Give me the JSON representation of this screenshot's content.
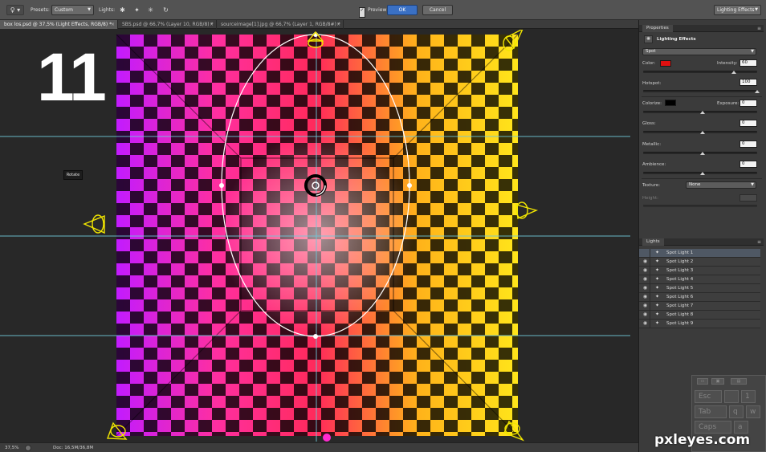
{
  "options_bar": {
    "tool_icon": "lightbulb-icon",
    "presets_label": "Presets:",
    "presets_value": "Custom",
    "lights_label": "Lights:",
    "preview_label": "Preview",
    "preview_checked": "✓",
    "ok_label": "OK",
    "cancel_label": "Cancel",
    "workspace_value": "Lighting Effects"
  },
  "tabs": [
    {
      "label": "box los.psd @ 37,5% (Light Effects, RGB/8) *",
      "active": true
    },
    {
      "label": "SBS.psd @ 66,7% (Layer 10, RGB/8) *",
      "active": false
    },
    {
      "label": "sourceimage[1].jpg @ 66,7% (Layer 1, RGB/8#) *",
      "active": false
    }
  ],
  "canvas": {
    "overlay_number": "11",
    "tooltip": "Rotate"
  },
  "status": {
    "zoom": "37,5%",
    "doc": "Doc: 16,5M/36,8M"
  },
  "properties": {
    "panel_title": "Properties",
    "effect_title": "Lighting Effects",
    "light_type": "Spot",
    "color_label": "Color:",
    "color_value": "#e01010",
    "intensity_label": "Intensity:",
    "intensity": "60",
    "hotspot_label": "Hotspot:",
    "hotspot": "100",
    "colorize_label": "Colorize:",
    "colorize_value": "#000000",
    "exposure_label": "Exposure:",
    "exposure": "0",
    "gloss_label": "Gloss:",
    "gloss": "0",
    "metallic_label": "Metallic:",
    "metallic": "0",
    "ambience_label": "Ambience:",
    "ambience": "0",
    "texture_label": "Texture:",
    "texture_value": "None",
    "height_label": "Height:"
  },
  "lights_panel": {
    "title": "Lights",
    "items": [
      "Spot Light 1",
      "Spot Light 2",
      "Spot Light 3",
      "Spot Light 4",
      "Spot Light 5",
      "Spot Light 6",
      "Spot Light 7",
      "Spot Light 8",
      "Spot Light 9"
    ]
  },
  "keyboard": {
    "keys": [
      "Esc",
      "Tab",
      "Caps",
      "1",
      "q",
      "w",
      "a"
    ]
  },
  "watermark": "pxleyes.com"
}
